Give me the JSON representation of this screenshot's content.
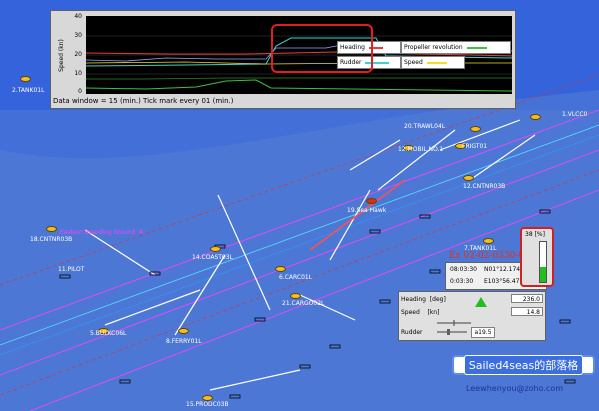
{
  "chart": {
    "ylabel": "Speed (kn)",
    "yticks": [
      "40",
      "30",
      "20",
      "10",
      "0"
    ],
    "footer": "Data window = 15 (min.)     Tick mark every  01 (min.)",
    "legend": {
      "heading": "Heading",
      "propeller": "Propeller revolution",
      "rudder": "Rudder",
      "speed": "Speed"
    },
    "colors": {
      "heading": "#e04040",
      "propeller": "#40c040",
      "rudder": "#40d0d0",
      "speed": "#f0e020"
    }
  },
  "targets": [
    {
      "name": "2.TANK01L"
    },
    {
      "name": "20.TRAWL04L"
    },
    {
      "name": "1.VLCC0"
    },
    {
      "name": "12.MOBIL NO.1"
    },
    {
      "name": "FRIGT01"
    },
    {
      "name": "12.CNTNR03B"
    },
    {
      "name": "19.Sea Hawk"
    },
    {
      "name": "18.CNTNR03B"
    },
    {
      "name": "Eastern Boarding Ground 'A'"
    },
    {
      "name": "11.PILOT"
    },
    {
      "name": "14.COAST03L"
    },
    {
      "name": "7.TANK01L"
    },
    {
      "name": "6.CARC01L"
    },
    {
      "name": "21.CARGO02L"
    },
    {
      "name": "5.BULKC06L"
    },
    {
      "name": "8.FERRY01L"
    },
    {
      "name": "15.PRODC03B"
    }
  ],
  "status": {
    "date": "Ex 02-02-0330-03",
    "time1": "08:03:30",
    "lat": "N01°12.174'",
    "time2": "0:03:30",
    "lon": "E103°56.477'"
  },
  "gauge": {
    "value": "38",
    "unit": "[%]",
    "fill_fraction": 0.38
  },
  "heading_panel": {
    "heading_label": "Heading",
    "heading_unit": "[deg]",
    "heading_value": "236.0",
    "speed_label": "Speed",
    "speed_unit": "[kn]",
    "speed_value": "14.8",
    "rudder_label": "Rudder",
    "rudder_value": "a19.5"
  },
  "blog": {
    "title": "Sailed4seas的部落格"
  },
  "email": "Leewhenyou@zoho.com"
}
